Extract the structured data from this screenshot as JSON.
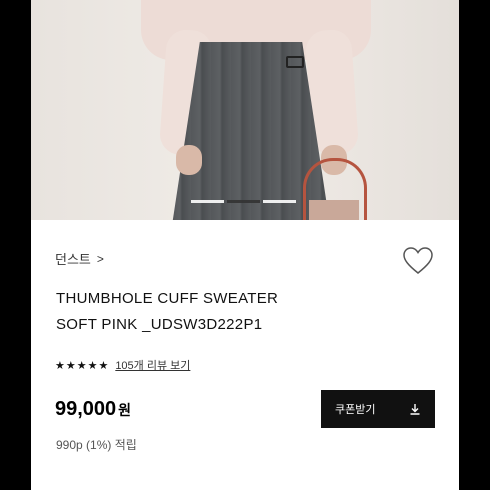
{
  "product": {
    "brand": "던스트",
    "brand_chevron": ">",
    "title_line1": "THUMBHOLE CUFF SWEATER",
    "title_line2": "SOFT PINK _UDSW3D222P1",
    "rating": {
      "stars": "★★★★★",
      "review_text": "105개 리뷰 보기"
    },
    "price_value": "99,000",
    "price_unit": "원",
    "points": "990p (1%) 적립"
  },
  "coupon": {
    "label": "쿠폰받기",
    "icon": "download-icon"
  },
  "image_gallery": {
    "total_slides": 3,
    "active_slide": 2
  },
  "icons": {
    "wishlist": "heart-icon"
  },
  "colors": {
    "button_bg": "#111111",
    "button_text": "#ffffff"
  }
}
